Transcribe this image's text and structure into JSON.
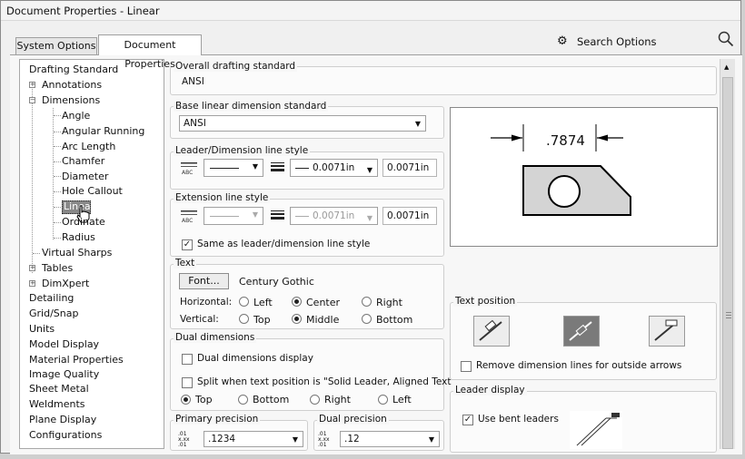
{
  "window": {
    "title": "Document Properties - Linear"
  },
  "tabs": {
    "system": "System Options",
    "document": "Document Properties"
  },
  "search": {
    "label": "Search Options",
    "gear_icon": "gear-icon",
    "search_icon": "search-icon"
  },
  "tree": {
    "drafting_standard": "Drafting Standard",
    "annotations": "Annotations",
    "dimensions": "Dimensions",
    "angle": "Angle",
    "angular_running": "Angular Running",
    "arc_length": "Arc Length",
    "chamfer": "Chamfer",
    "diameter": "Diameter",
    "hole_callout": "Hole Callout",
    "linear": "Linear",
    "ordinate": "Ordinate",
    "radius": "Radius",
    "virtual_sharps": "Virtual Sharps",
    "tables": "Tables",
    "dimxpert": "DimXpert",
    "detailing": "Detailing",
    "grid_snap": "Grid/Snap",
    "units": "Units",
    "model_display": "Model Display",
    "material_properties": "Material Properties",
    "image_quality": "Image Quality",
    "sheet_metal": "Sheet Metal",
    "weldments": "Weldments",
    "plane_display": "Plane Display",
    "configurations": "Configurations"
  },
  "overall": {
    "label": "Overall drafting standard",
    "value": "ANSI"
  },
  "base_linear": {
    "label": "Base linear dimension standard",
    "value": "ANSI"
  },
  "leader_style": {
    "label": "Leader/Dimension line style",
    "thickness": "0.0071in",
    "custom": "0.0071in"
  },
  "extension_style": {
    "label": "Extension line style",
    "thickness": "0.0071in",
    "custom": "0.0071in",
    "same_as": "Same as leader/dimension line style",
    "same_as_checked": true
  },
  "text": {
    "label": "Text",
    "font_button": "Font...",
    "font_name": "Century Gothic",
    "horizontal_label": "Horizontal:",
    "vertical_label": "Vertical:",
    "h_left": "Left",
    "h_center": "Center",
    "h_right": "Right",
    "v_top": "Top",
    "v_middle": "Middle",
    "v_bottom": "Bottom",
    "horizontal_selected": "Center",
    "vertical_selected": "Middle"
  },
  "dual": {
    "label": "Dual dimensions",
    "display": "Dual dimensions display",
    "split": "Split when text position is \"Solid Leader, Aligned Text\"",
    "top": "Top",
    "bottom": "Bottom",
    "right": "Right",
    "left": "Left",
    "selected": "Top"
  },
  "precision": {
    "primary_label": "Primary precision",
    "primary_value": ".1234",
    "dual_label": "Dual precision",
    "dual_value": ".12"
  },
  "preview": {
    "dimension_text": ".7874"
  },
  "text_position": {
    "label": "Text position",
    "remove_lines": "Remove dimension lines for outside arrows"
  },
  "leader_display": {
    "label": "Leader display",
    "use_bent": "Use bent leaders",
    "use_bent_checked": true
  },
  "colors": {
    "selection": "#888888",
    "window_bg": "#f0f0f0",
    "preview_shape": "#d4d4d4"
  }
}
